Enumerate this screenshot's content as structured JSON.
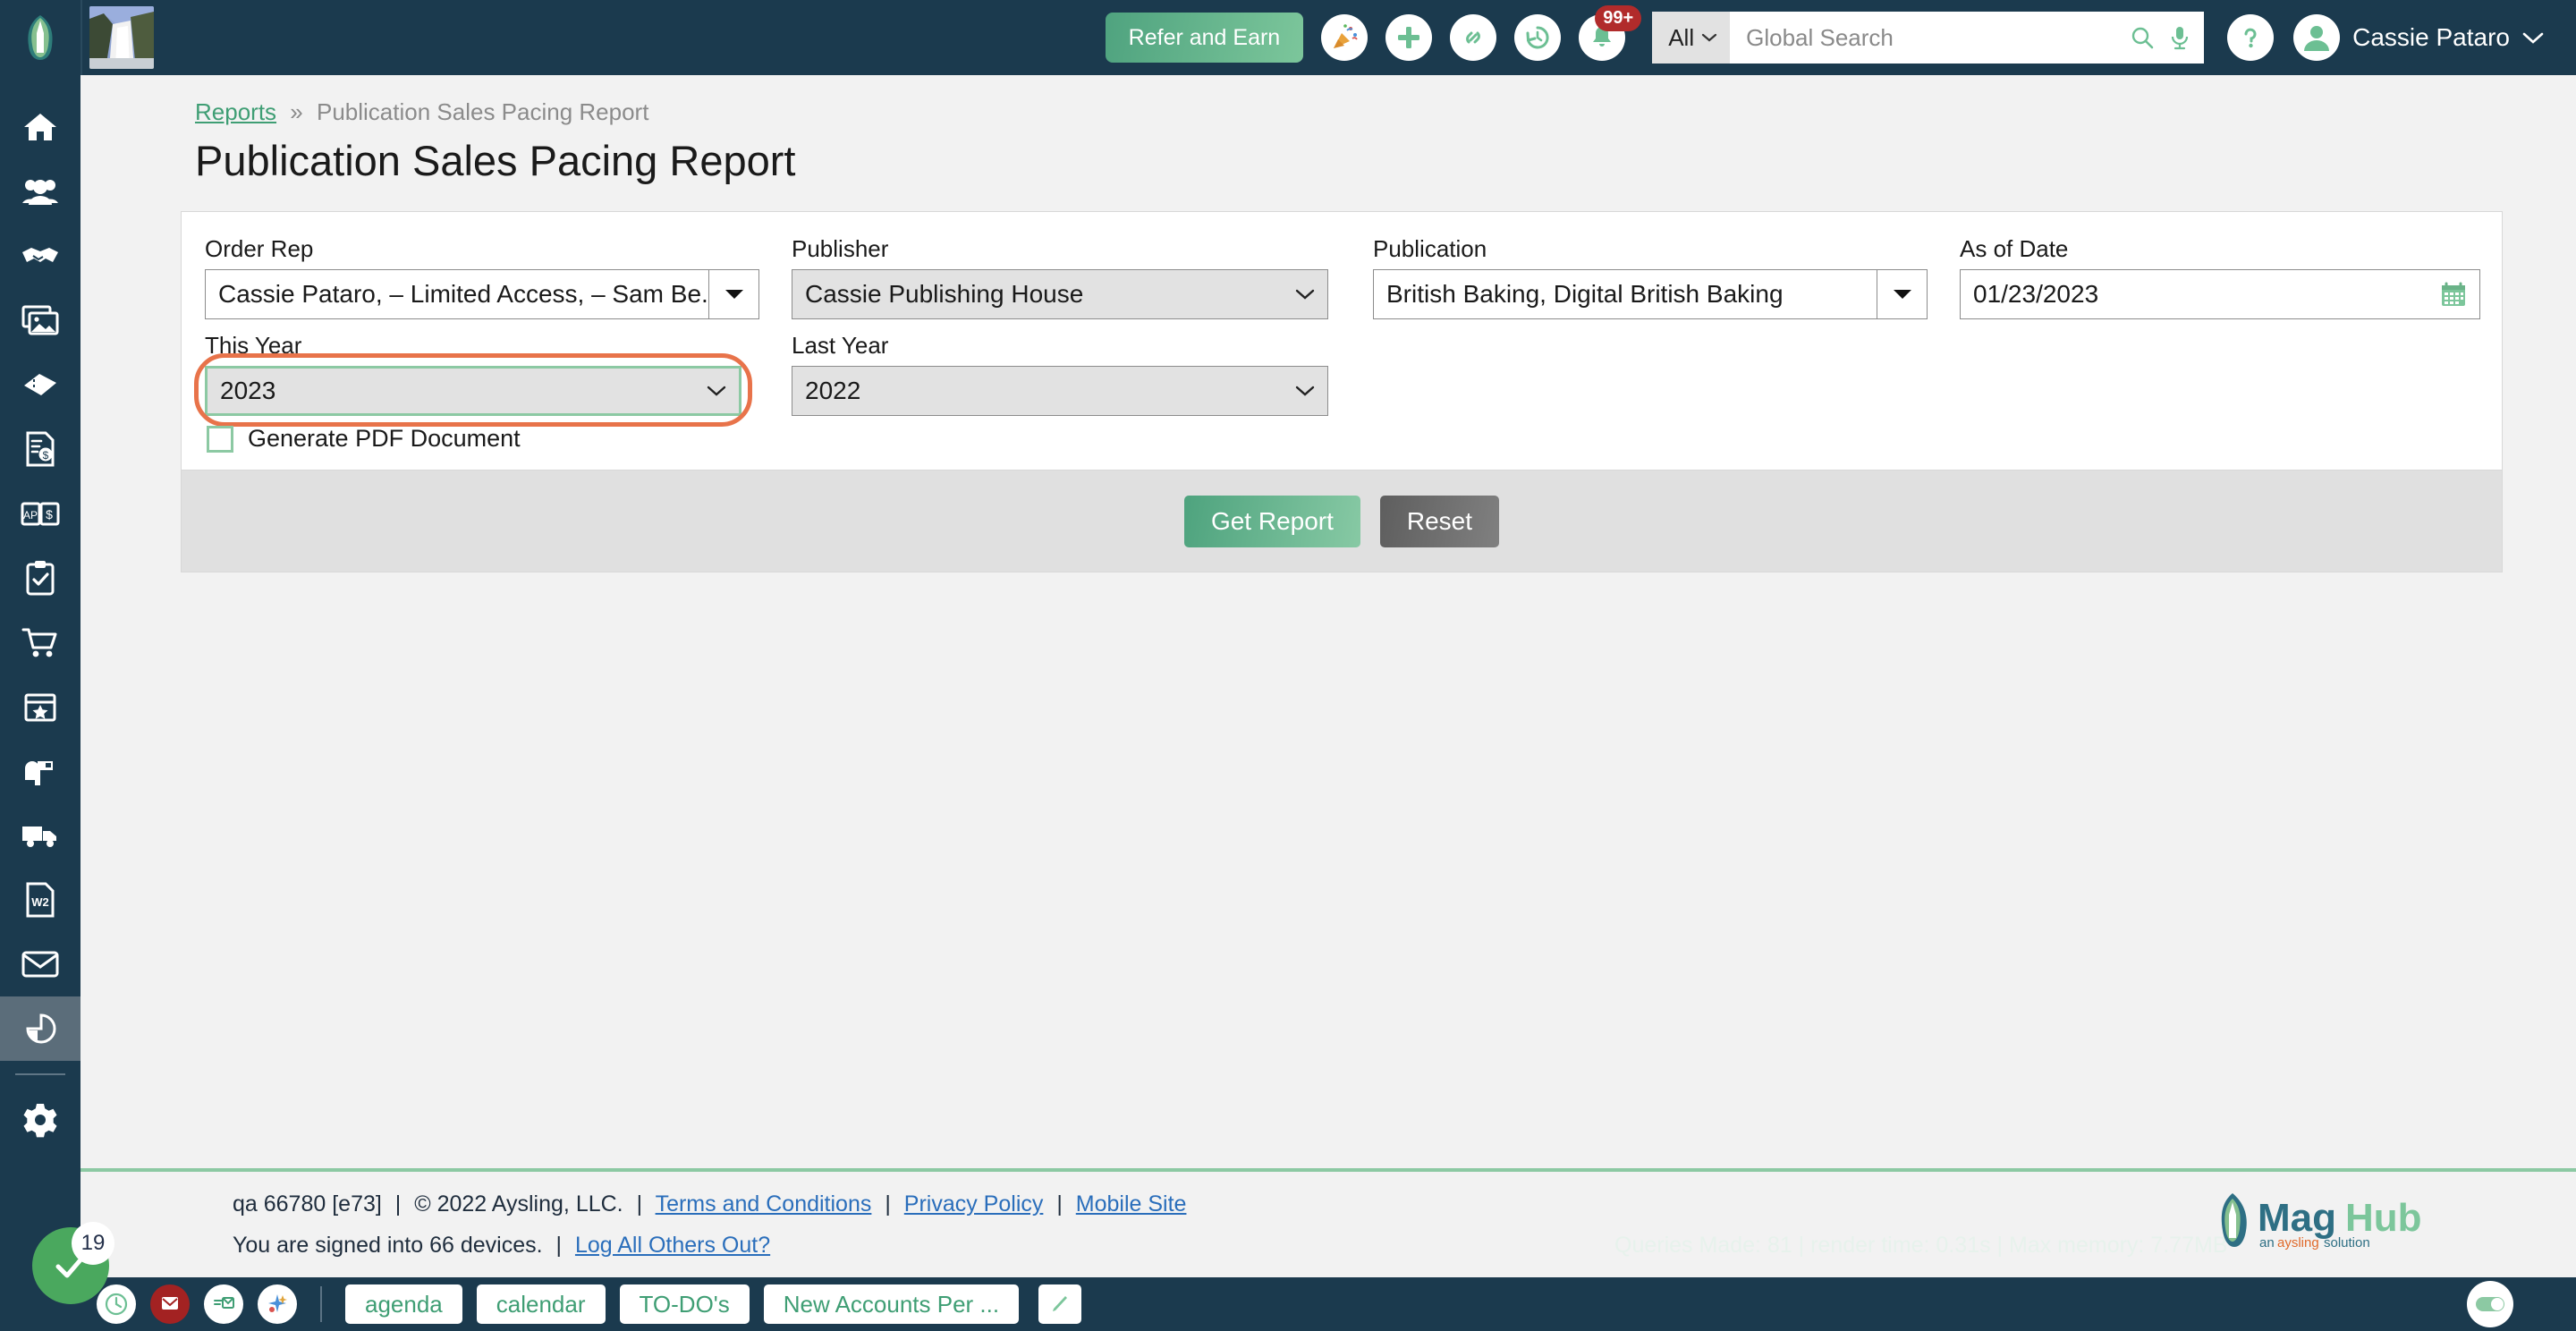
{
  "header": {
    "brand_icon": "maghub-logo-icon",
    "thumbnail_alt": "waterfall-thumbnail",
    "refer_label": "Refer and Earn",
    "icons": [
      {
        "name": "party-popper-icon",
        "label": "celebration"
      },
      {
        "name": "plus-icon",
        "label": "add"
      },
      {
        "name": "link-icon",
        "label": "link"
      },
      {
        "name": "history-clock-icon",
        "label": "recent"
      },
      {
        "name": "bell-icon",
        "label": "notifications",
        "badge": "99+"
      }
    ],
    "search": {
      "scope": "All",
      "placeholder": "Global Search",
      "value": "",
      "search_icon": "search-icon",
      "mic_icon": "microphone-icon"
    },
    "help_icon": "question-mark-icon",
    "user_name": "Cassie Pataro"
  },
  "sidebar": {
    "items": [
      {
        "name": "home",
        "icon": "home-icon",
        "active": false
      },
      {
        "name": "contacts",
        "icon": "people-icon",
        "active": false
      },
      {
        "name": "deals",
        "icon": "handshake-icon",
        "active": false
      },
      {
        "name": "media",
        "icon": "image-icon",
        "active": false
      },
      {
        "name": "tickets",
        "icon": "ticket-icon",
        "active": false
      },
      {
        "name": "invoices",
        "icon": "invoice-dollar-icon",
        "active": false
      },
      {
        "name": "accounts-payable",
        "icon": "ap-book-dollar-icon",
        "active": false
      },
      {
        "name": "tasks",
        "icon": "clipboard-check-icon",
        "active": false
      },
      {
        "name": "orders",
        "icon": "shopping-cart-icon",
        "active": false
      },
      {
        "name": "events",
        "icon": "calendar-star-icon",
        "active": false
      },
      {
        "name": "mailbox",
        "icon": "mailbox-icon",
        "active": false
      },
      {
        "name": "shipping",
        "icon": "truck-icon",
        "active": false
      },
      {
        "name": "w2-forms",
        "icon": "w2-document-icon",
        "active": false
      },
      {
        "name": "messages",
        "icon": "envelope-icon",
        "active": false
      },
      {
        "name": "reports",
        "icon": "pie-chart-icon",
        "active": true
      }
    ],
    "settings": {
      "name": "settings",
      "icon": "gear-icon"
    }
  },
  "breadcrumb": {
    "root": "Reports",
    "separator": "»",
    "current": "Publication Sales Pacing Report"
  },
  "page": {
    "title": "Publication Sales Pacing Report"
  },
  "form": {
    "order_rep": {
      "label": "Order Rep",
      "value": "Cassie Pataro, – Limited Access, – Sam Be...",
      "arrow_icon": "caret-down-icon"
    },
    "publisher": {
      "label": "Publisher",
      "value": "Cassie Publishing House",
      "arrow_icon": "chevron-down-icon"
    },
    "publication": {
      "label": "Publication",
      "value": "British Baking, Digital British Baking",
      "arrow_icon": "caret-down-icon"
    },
    "as_of_date": {
      "label": "As of Date",
      "value": "01/23/2023",
      "icon": "calendar-icon"
    },
    "this_year": {
      "label": "This Year",
      "value": "2023",
      "arrow_icon": "chevron-down-icon",
      "focused": true,
      "highlight_color": "#e8734a"
    },
    "last_year": {
      "label": "Last Year",
      "value": "2022",
      "arrow_icon": "chevron-down-icon"
    },
    "generate_pdf": {
      "label": "Generate PDF Document",
      "checked": false
    },
    "get_report_label": "Get Report",
    "reset_label": "Reset"
  },
  "footer": {
    "build": "qa 66780 [e73]",
    "sep": "|",
    "copyright": "© 2022 Aysling, LLC.",
    "terms": "Terms and Conditions",
    "privacy": "Privacy Policy",
    "mobile": "Mobile Site",
    "devices_text": "You are signed into 66 devices.",
    "logout_all": "Log All Others Out?",
    "perf": "Queries Made: 81 | render time: 0.31s | Max memory: 7.77MB",
    "logo_text": "MagHub",
    "logo_tagline": "an aysling solution"
  },
  "fab": {
    "icon": "check-icon",
    "badge": "19"
  },
  "taskbar": {
    "icons": [
      {
        "name": "clock-icon",
        "style": "white"
      },
      {
        "name": "mail-alert-icon",
        "style": "red"
      },
      {
        "name": "mail-read-icon",
        "style": "white"
      },
      {
        "name": "activity-icon",
        "style": "white"
      }
    ],
    "tabs": [
      "agenda",
      "calendar",
      "TO-DO's",
      "New Accounts Per ..."
    ],
    "pencil_icon": "pencil-icon",
    "toggle_icon": "toggle-on-icon"
  }
}
